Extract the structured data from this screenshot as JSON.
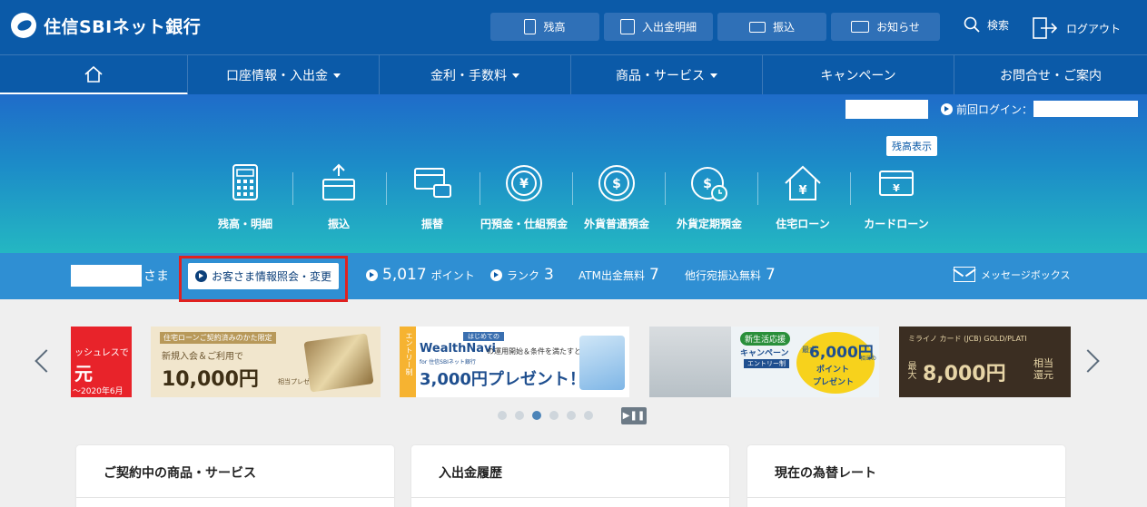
{
  "header": {
    "logo_text": "住信SBIネット銀行",
    "buttons": [
      {
        "label": "残高",
        "icon": "calculator-icon"
      },
      {
        "label": "入出金明細",
        "icon": "statement-icon"
      },
      {
        "label": "振込",
        "icon": "transfer-icon"
      },
      {
        "label": "お知らせ",
        "icon": "mail-icon"
      }
    ],
    "search_label": "検索",
    "logout_label": "ログアウト"
  },
  "nav": {
    "items": [
      "口座情報・入出金",
      "金利・手数料",
      "商品・サービス",
      "キャンペーン",
      "お問合せ・ご案内"
    ]
  },
  "hero": {
    "last_login_label": "前回ログイン：",
    "balance_show_label": "残高表示",
    "quick_menu": [
      {
        "label": "残高・明細",
        "icon": "calculator-icon"
      },
      {
        "label": "振込",
        "icon": "transfer-card-icon"
      },
      {
        "label": "振替",
        "icon": "exchange-card-icon"
      },
      {
        "label": "円預金・仕組預金",
        "icon": "yen-coin-icon"
      },
      {
        "label": "外貨普通預金",
        "icon": "dollar-coin-icon"
      },
      {
        "label": "外貨定期預金",
        "icon": "dollar-clock-icon"
      },
      {
        "label": "住宅ローン",
        "icon": "house-yen-icon"
      },
      {
        "label": "カードローン",
        "icon": "card-yen-icon"
      }
    ]
  },
  "infobar": {
    "honorific": "さま",
    "profile_button": "お客さま情報照会・変更",
    "points_value": "5,017",
    "points_label": "ポイント",
    "rank_label": "ランク",
    "rank_value": "3",
    "atm_label": "ATM出金無料",
    "atm_value": "7",
    "transfer_label": "他行宛振込無料",
    "transfer_value": "7",
    "message_box": "メッセージボックス"
  },
  "banners": [
    {
      "lines": [
        "ッシュレスで",
        "元",
        "～2020年6月"
      ]
    },
    {
      "lines": [
        "住宅ローンご契約済みのかた限定",
        "新規入会＆ご利用で",
        "10,000円",
        "相当プレゼント！"
      ]
    },
    {
      "lines": [
        "エントリー制",
        "はじめての",
        "WealthNavi",
        "for 住信SBIネット銀行",
        "の運用開始＆条件を満たすと",
        "3,000円プレゼント！"
      ]
    },
    {
      "lines": [
        "新生活応援",
        "キャンペーン",
        "エントリー制",
        "最大",
        "6,000円",
        "相当の",
        "ポイント",
        "プレゼント"
      ]
    },
    {
      "lines": [
        "ミライノ カード (JCB) GOLD/PLATI",
        "最大",
        "8,000円",
        "相当還元"
      ]
    }
  ],
  "pause_label": "▶❚❚",
  "cards": [
    {
      "title": "ご契約中の商品・サービス"
    },
    {
      "title": "入出金履歴"
    },
    {
      "title": "現在の為替レート"
    }
  ],
  "colors": {
    "header_bg": "#0b5aa8",
    "highlight_border": "#e0211f",
    "infobar_bg": "#2f8fd3"
  }
}
